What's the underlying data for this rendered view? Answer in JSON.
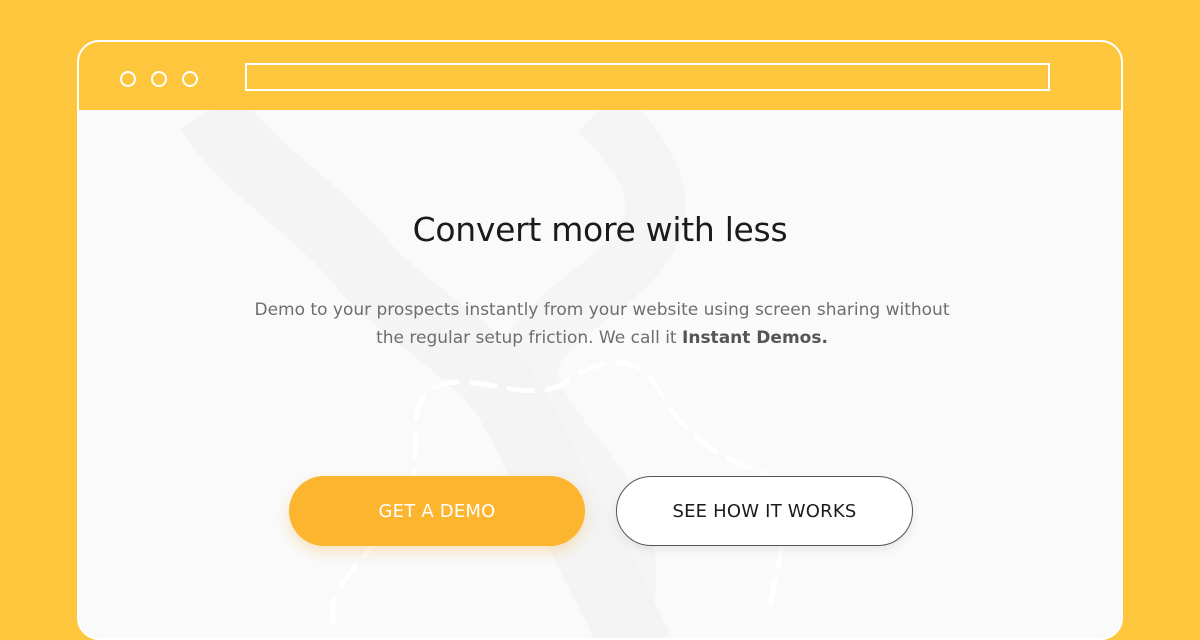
{
  "colors": {
    "background": "#FDC63D",
    "window_border": "#FFFFFF",
    "content_background": "#FAFAFA",
    "primary_button": "#FBB52F",
    "headline": "#1B1B1B",
    "description": "#6E6E6E"
  },
  "browser": {
    "window_controls": [
      "circle-icon",
      "circle-icon",
      "circle-icon"
    ],
    "address_bar_value": ""
  },
  "hero": {
    "headline": "Convert more with less",
    "description_main": "Demo to your prospects instantly from your website using screen sharing without the regular setup friction. We call it ",
    "description_emphasis": "Instant Demos."
  },
  "buttons": {
    "primary_label": "GET A DEMO",
    "secondary_label": "SEE HOW IT WORKS"
  }
}
